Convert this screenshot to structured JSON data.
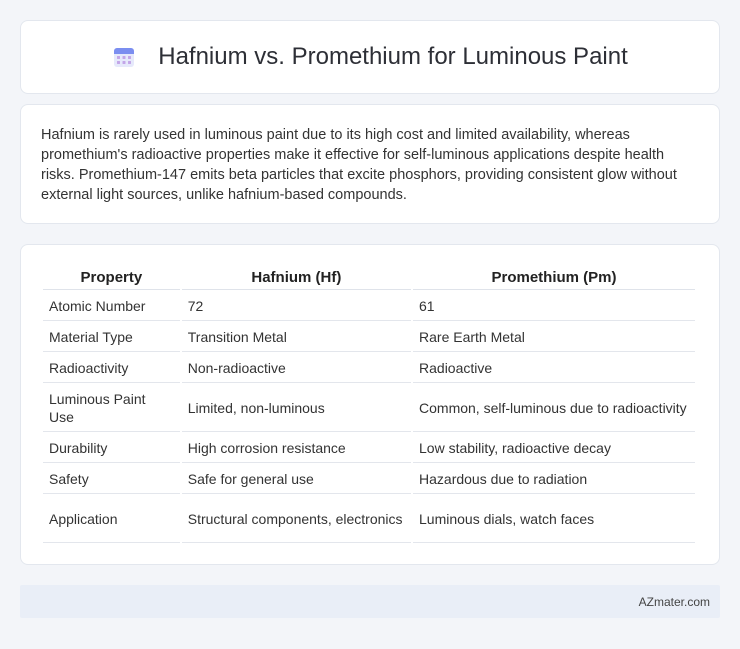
{
  "header": {
    "title": "Hafnium vs. Promethium for Luminous Paint",
    "icon": "calendar-icon",
    "accent": "#7b8ef0"
  },
  "intro": {
    "text": "Hafnium is rarely used in luminous paint due to its high cost and limited availability, whereas promethium's radioactive properties make it effective for self-luminous applications despite health risks. Promethium-147 emits beta particles that excite phosphors, providing consistent glow without external light sources, unlike hafnium-based compounds."
  },
  "table": {
    "headers": [
      "Property",
      "Hafnium (Hf)",
      "Promethium (Pm)"
    ],
    "rows": [
      [
        "Atomic Number",
        "72",
        "61"
      ],
      [
        "Material Type",
        "Transition Metal",
        "Rare Earth Metal"
      ],
      [
        "Radioactivity",
        "Non-radioactive",
        "Radioactive"
      ],
      [
        "Luminous Paint Use",
        "Limited, non-luminous",
        "Common, self-luminous due to radioactivity"
      ],
      [
        "Durability",
        "High corrosion resistance",
        "Low stability, radioactive decay"
      ],
      [
        "Safety",
        "Safe for general use",
        "Hazardous due to radiation"
      ],
      [
        "Application",
        "Structural components, electronics",
        "Luminous dials, watch faces"
      ]
    ]
  },
  "footer": {
    "site": "AZmater.com"
  }
}
